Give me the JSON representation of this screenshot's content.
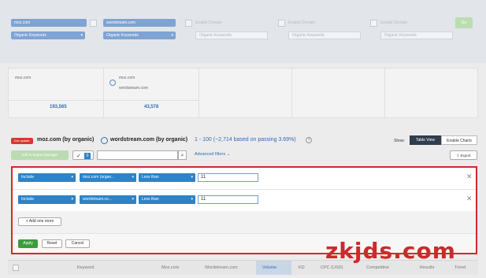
{
  "top_filters": {
    "chips": [
      "moz.com",
      "wordstream.com",
      "Organic Keywords",
      "Organic Keywords"
    ],
    "checkbox_labels": [
      "Enable Domain",
      "Enable Domain",
      "Enable Domain"
    ],
    "placeholders": [
      "Organic Keywords",
      "Organic Keywords",
      "Organic Keywords"
    ],
    "go_label": "Go"
  },
  "comparison": {
    "domain1": "moz.com",
    "domain2_line1": "moz.com",
    "domain2_line2": "wordstream.com",
    "value1": "193,565",
    "value2": "43,578"
  },
  "header": {
    "badge": "live update",
    "title_part1": "moz.com (by organic)",
    "title_part2": "wordstream.com (by organic)",
    "range_text": "1 - 100 (~2,714 based on passing 3.69%)",
    "help_icon": "question-icon",
    "show_label": "Show:",
    "table_view": "Table View",
    "enable_charts": "Enable Charts"
  },
  "toolbar": {
    "add_to_export": "Add to Export Manager",
    "checkbox_count": "0",
    "search_placeholder": "",
    "advanced_filters": "Advanced filters",
    "export": "Export"
  },
  "filters": [
    {
      "mode": "Include",
      "field": "moz.com (organ...",
      "op": "Less than",
      "value": "11"
    },
    {
      "mode": "Include",
      "field": "wordstream.co...",
      "op": "Less than",
      "value": "11"
    }
  ],
  "add_one_more": "Add one more",
  "actions": {
    "apply": "Apply",
    "reset": "Reset",
    "cancel": "Cancel"
  },
  "columns": [
    "Keyword",
    "Moz.com",
    "Wordstream.com",
    "Volume",
    "KD",
    "CPC (USD)",
    "Competitive",
    "Results",
    "Trend"
  ],
  "watermark": "zkjds.com",
  "colors": {
    "accent_blue": "#2e83c6",
    "apply_green": "#3c9c3e",
    "panel_border": "#d7262c"
  }
}
